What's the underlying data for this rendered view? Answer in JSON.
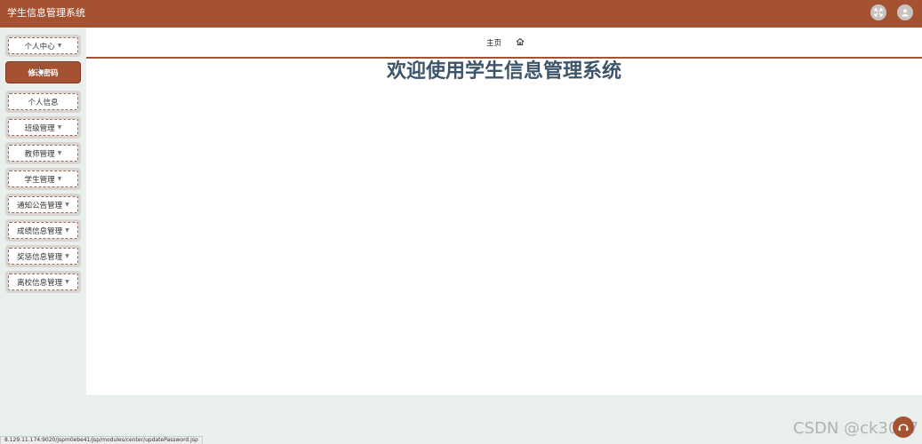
{
  "header": {
    "title": "学生信息管理系统",
    "icons": [
      "fullscreen-toggle-icon",
      "user-avatar-icon"
    ]
  },
  "sidebar": {
    "items": [
      {
        "label": "个人中心",
        "has_dropdown": true,
        "state": "expanded"
      },
      {
        "label": "修改密码",
        "has_dropdown": false,
        "state": "active-hover"
      },
      {
        "label": "个人信息",
        "has_dropdown": false,
        "state": "normal"
      },
      {
        "label": "班级管理",
        "has_dropdown": true,
        "state": "normal"
      },
      {
        "label": "教师管理",
        "has_dropdown": true,
        "state": "normal"
      },
      {
        "label": "学生管理",
        "has_dropdown": true,
        "state": "normal"
      },
      {
        "label": "通知公告管理",
        "has_dropdown": true,
        "state": "normal"
      },
      {
        "label": "成绩信息管理",
        "has_dropdown": true,
        "state": "normal"
      },
      {
        "label": "奖惩信息管理",
        "has_dropdown": true,
        "state": "normal"
      },
      {
        "label": "离校信息管理",
        "has_dropdown": true,
        "state": "normal"
      }
    ],
    "dropdown_glyph": "▼"
  },
  "tabs": {
    "home_label": "主页",
    "home_icon": "home-icon"
  },
  "main": {
    "welcome": "欢迎使用学生信息管理系统"
  },
  "statusbar": {
    "url": "8.129.11.174:9020/jspm0ebe41/jsp/modules/center/updatePassword.jsp"
  },
  "watermark": {
    "text": "CSDN @ck3007"
  },
  "colors": {
    "brand": "#a45232",
    "title_text": "#3d556b",
    "background": "#e9efec"
  }
}
